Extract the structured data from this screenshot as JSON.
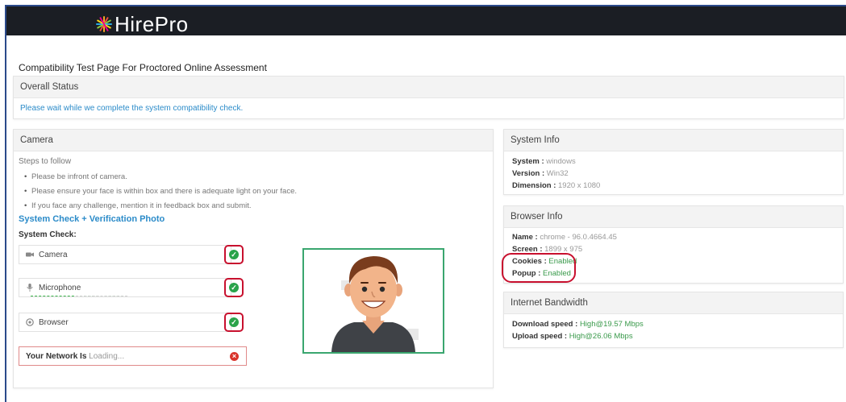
{
  "app": {
    "logo_text": "HirePro"
  },
  "page": {
    "title": "Compatibility Test Page For Proctored Online Assessment"
  },
  "overall": {
    "heading": "Overall Status",
    "message": "Please wait while we complete the system compatibility check."
  },
  "camera": {
    "heading": "Camera",
    "steps_label": "Steps to follow",
    "steps": [
      "Please be infront of camera.",
      "Please ensure your face is within box and there is adequate light on your face.",
      "If you face any challenge, mention it in feedback box and submit."
    ],
    "verification_title": "System Check + Verification Photo",
    "system_check_label": "System Check:",
    "checks": [
      {
        "label": "Camera",
        "icon": "camera-icon",
        "status": "ok"
      },
      {
        "label": "Microphone",
        "icon": "microphone-icon",
        "status": "ok"
      },
      {
        "label": "Browser",
        "icon": "browser-icon",
        "status": "ok"
      }
    ],
    "network": {
      "label": "Your Network Is",
      "value": "Loading...",
      "status": "error"
    }
  },
  "system_info": {
    "heading": "System Info",
    "rows": [
      {
        "key": "System",
        "value": "windows"
      },
      {
        "key": "Version",
        "value": "Win32"
      },
      {
        "key": "Dimension",
        "value": "1920 x 1080"
      }
    ]
  },
  "browser_info": {
    "heading": "Browser Info",
    "rows": [
      {
        "key": "Name",
        "value": "chrome - 96.0.4664.45"
      },
      {
        "key": "Screen",
        "value": "1899 x 975"
      },
      {
        "key": "Cookies",
        "value": "Enabled"
      },
      {
        "key": "Popup",
        "value": "Enabled"
      }
    ]
  },
  "bandwidth": {
    "heading": "Internet Bandwidth",
    "rows": [
      {
        "key": "Download speed",
        "value": "High@19.57 Mbps"
      },
      {
        "key": "Upload speed",
        "value": "High@26.06 Mbps"
      }
    ]
  },
  "colors": {
    "topbar": "#1b1e24",
    "accent_blue": "#2b8bc9",
    "ok_green": "#2aa34a",
    "error_red": "#d9342b",
    "highlight_red": "#c8102e",
    "photo_border": "#3aa66f"
  }
}
